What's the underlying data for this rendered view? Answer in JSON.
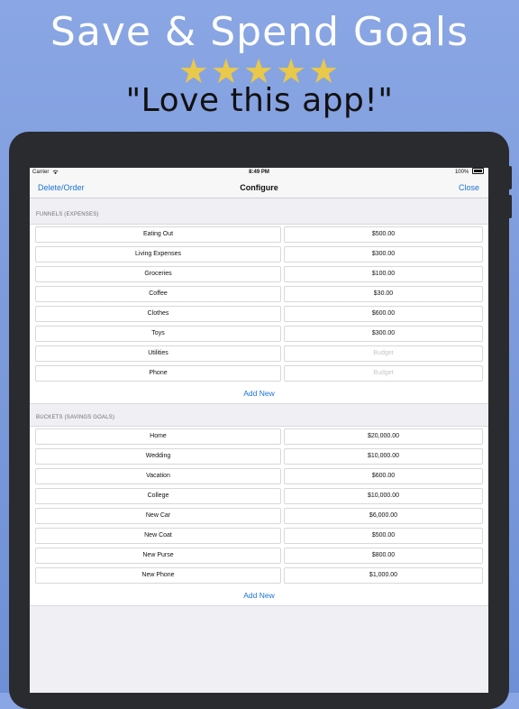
{
  "promo": {
    "headline": "Save & Spend Goals",
    "stars": [
      "★",
      "★",
      "★",
      "★",
      "★"
    ],
    "star_color": "#e9c84a",
    "quote": "\"Love this app!\""
  },
  "statusbar": {
    "carrier": "Carrier",
    "time": "8:49 PM",
    "battery": "100%"
  },
  "navbar": {
    "left_button": "Delete/Order",
    "title": "Configure",
    "right_button": "Close",
    "accent": "#1a73d9"
  },
  "funnels": {
    "header": "FUNNELS (EXPENSES)",
    "rows": [
      {
        "name": "Eating Out",
        "value": "$500.00"
      },
      {
        "name": "Living Expenses",
        "value": "$300.00"
      },
      {
        "name": "Groceries",
        "value": "$100.00"
      },
      {
        "name": "Coffee",
        "value": "$30.00"
      },
      {
        "name": "Clothes",
        "value": "$600.00"
      },
      {
        "name": "Toys",
        "value": "$300.00"
      },
      {
        "name": "Utilities",
        "value": "",
        "placeholder": "Budget"
      },
      {
        "name": "Phone",
        "value": "",
        "placeholder": "Budget"
      }
    ],
    "add_label": "Add New"
  },
  "buckets": {
    "header": "BUCKETS (SAVINGS GOALS)",
    "rows": [
      {
        "name": "Home",
        "value": "$20,000.00"
      },
      {
        "name": "Wedding",
        "value": "$10,000.00"
      },
      {
        "name": "Vacation",
        "value": "$600.00"
      },
      {
        "name": "College",
        "value": "$10,000.00"
      },
      {
        "name": "New Car",
        "value": "$6,000.00"
      },
      {
        "name": "New Coat",
        "value": "$500.00"
      },
      {
        "name": "New Purse",
        "value": "$800.00"
      },
      {
        "name": "New Phone",
        "value": "$1,000.00"
      }
    ],
    "add_label": "Add New"
  }
}
